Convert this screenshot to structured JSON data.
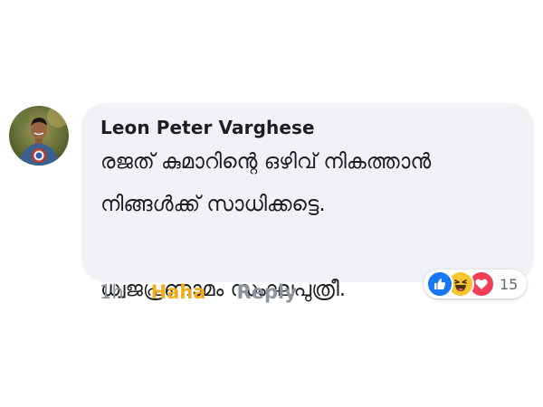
{
  "comment": {
    "author": "Leon Peter Varghese",
    "text_lines": [
      "രജത് കുമാറിന്റെ ഒഴിവ് നികത്താൻ",
      "നിങ്ങൾക്ക് സാധിക്കട്ടെ.",
      "",
      "ധ്വജപ്രണാമം സംഘപുത്രീ."
    ],
    "timestamp": "1h",
    "reaction_action": "Haha",
    "reply_label": "Reply"
  },
  "reactions": {
    "icons": [
      "like-icon",
      "haha-icon",
      "love-icon"
    ],
    "count": "15"
  },
  "colors": {
    "bubble": "#f1f2f6",
    "haha": "#f0ae1c",
    "meta": "#8d949e",
    "like": "#1877f2",
    "love": "#f33e58"
  }
}
